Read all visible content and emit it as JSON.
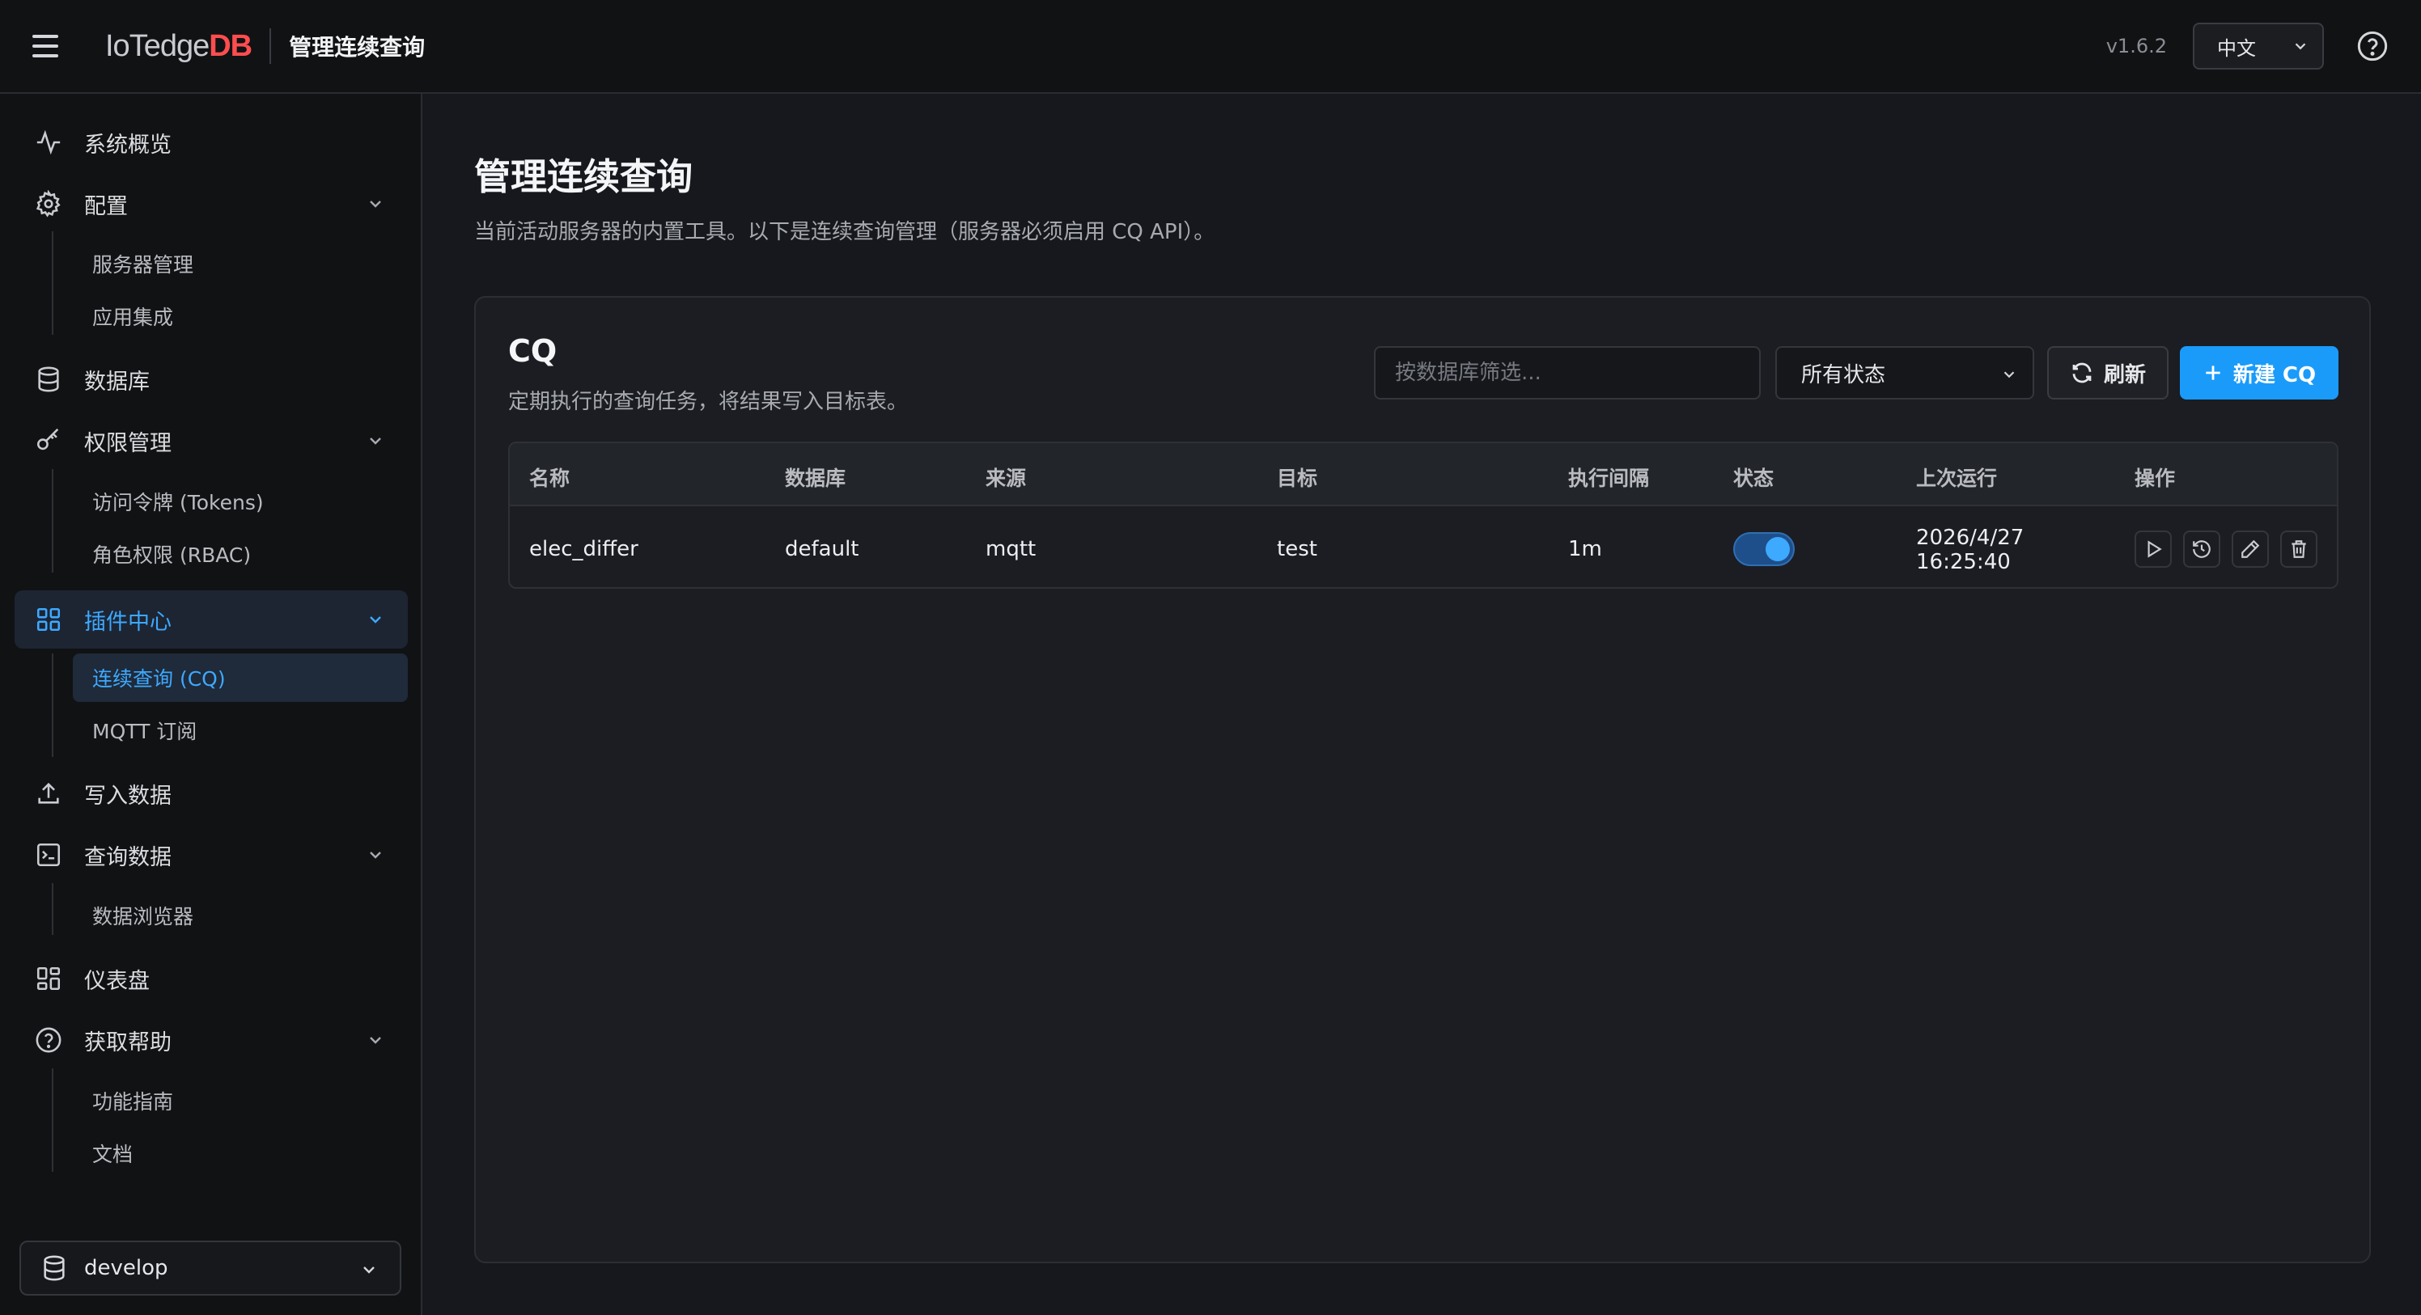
{
  "header": {
    "brand_prefix": "IoTedge",
    "brand_suffix": "DB",
    "title": "管理连续查询",
    "version": "v1.6.2",
    "language": "中文"
  },
  "sidebar": {
    "items": [
      {
        "label": "系统概览",
        "icon": "activity-icon"
      },
      {
        "label": "配置",
        "icon": "gear-icon",
        "children": [
          "服务器管理",
          "应用集成"
        ]
      },
      {
        "label": "数据库",
        "icon": "database-icon"
      },
      {
        "label": "权限管理",
        "icon": "key-icon",
        "children": [
          "访问令牌 (Tokens)",
          "角色权限 (RBAC)"
        ]
      },
      {
        "label": "插件中心",
        "icon": "grid-icon",
        "active": true,
        "children": [
          "连续查询 (CQ)",
          "MQTT 订阅"
        ]
      },
      {
        "label": "写入数据",
        "icon": "upload-icon"
      },
      {
        "label": "查询数据",
        "icon": "terminal-icon",
        "children": [
          "数据浏览器"
        ]
      },
      {
        "label": "仪表盘",
        "icon": "dashboard-icon"
      },
      {
        "label": "获取帮助",
        "icon": "help-circle-icon",
        "children": [
          "功能指南",
          "文档"
        ]
      }
    ],
    "database": "develop"
  },
  "main": {
    "title": "管理连续查询",
    "description": "当前活动服务器的内置工具。以下是连续查询管理（服务器必须启用 CQ API）。",
    "card": {
      "title": "CQ",
      "subtitle": "定期执行的查询任务，将结果写入目标表。",
      "filter_placeholder": "按数据库筛选...",
      "status_filter": "所有状态",
      "refresh_label": "刷新",
      "new_label": "新建 CQ",
      "columns": [
        "名称",
        "数据库",
        "来源",
        "目标",
        "执行间隔",
        "状态",
        "上次运行",
        "操作"
      ],
      "rows": [
        {
          "name": "elec_differ",
          "database": "default",
          "source": "mqtt",
          "target": "test",
          "interval": "1m",
          "enabled": true,
          "last_run_date": "2026/4/27",
          "last_run_time": "16:25:40"
        }
      ]
    }
  },
  "colors": {
    "accent": "#1a9bfa",
    "active_text": "#3da9ff",
    "brand_red": "#ff4d4f"
  }
}
